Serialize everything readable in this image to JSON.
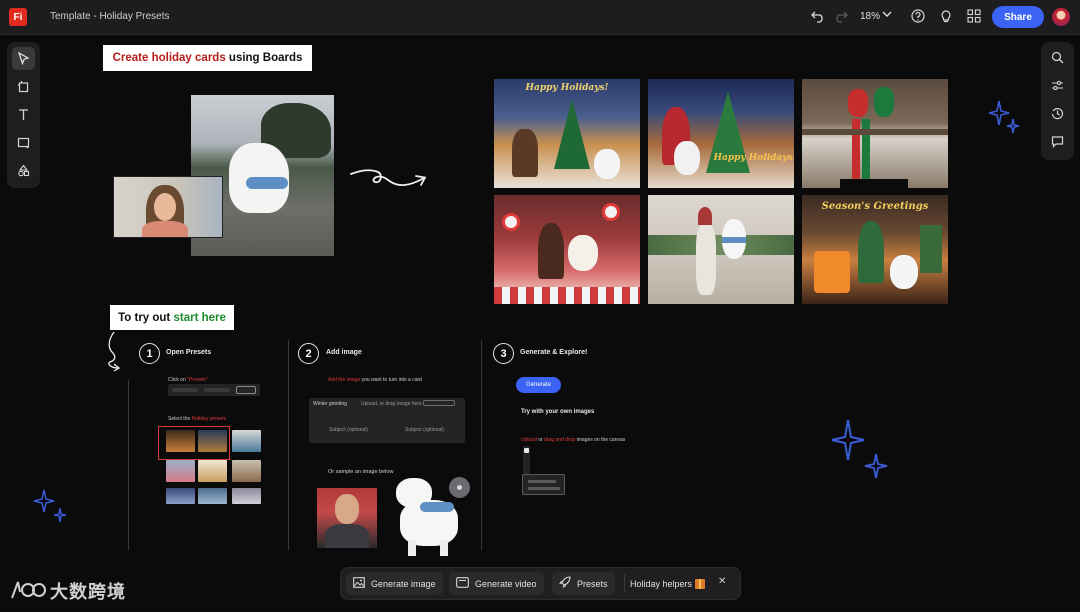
{
  "app": {
    "logo_text": "Fi",
    "document_title": "Template - Holiday Presets",
    "zoom_level": "18%",
    "share_label": "Share"
  },
  "left_tools": [
    {
      "name": "select",
      "icon": "pointer-icon",
      "active": true
    },
    {
      "name": "artboard",
      "icon": "artboard-icon"
    },
    {
      "name": "text",
      "icon": "text-icon"
    },
    {
      "name": "shape",
      "icon": "rectangle-icon"
    },
    {
      "name": "shapes-library",
      "icon": "shapes-icon"
    }
  ],
  "right_tools": [
    {
      "name": "search",
      "icon": "search-icon"
    },
    {
      "name": "adjust",
      "icon": "sliders-icon"
    },
    {
      "name": "history",
      "icon": "history-icon"
    },
    {
      "name": "comments",
      "icon": "comment-icon"
    }
  ],
  "canvas": {
    "title_card": {
      "part1": "Create holiday cards",
      "part2": " using Boards"
    },
    "tryout_card": {
      "part1": "To try out ",
      "part2": "start here"
    },
    "grid_captions": [
      "Happy Holidays!",
      "Happy Holidays!",
      "Season's Greetings"
    ]
  },
  "steps": [
    {
      "number": "1",
      "title": "Open Presets",
      "click_on_label": "Click on",
      "click_on_target": "\"Presets\"",
      "select_label": "Select the",
      "select_target": "Holiday presets"
    },
    {
      "number": "2",
      "title": "Add image",
      "instruction_red": "Add the image",
      "instruction_rest": " you want to turn into a card",
      "panel_title": "Winter greeting",
      "panel_prompt": "Upload, or drag image here",
      "panel_field_1": "Subject (optional)",
      "panel_field_2": "Subject (optional)",
      "sample_label": "Or sample an image below"
    },
    {
      "number": "3",
      "title": "Generate & Explore!",
      "generate_label": "Generate",
      "try_own_label": "Try with your own images",
      "try_own_red1": "Upload",
      "try_own_mid": " or ",
      "try_own_red2": "drag and drop",
      "try_own_rest": " images on the canvas"
    }
  ],
  "bottom_toolbar": {
    "items": [
      {
        "label": "Generate image",
        "icon": "image-icon"
      },
      {
        "label": "Generate video",
        "icon": "video-icon"
      },
      {
        "label": "Presets",
        "icon": "rocket-icon"
      },
      {
        "label": "Holiday helpers",
        "icon": "gift-icon"
      }
    ],
    "close_label": "✕"
  },
  "watermark": "大数跨境",
  "colors": {
    "accent": "#3b63f5",
    "brand": "#e22a1e",
    "sparkle": "#3b5cd6"
  }
}
